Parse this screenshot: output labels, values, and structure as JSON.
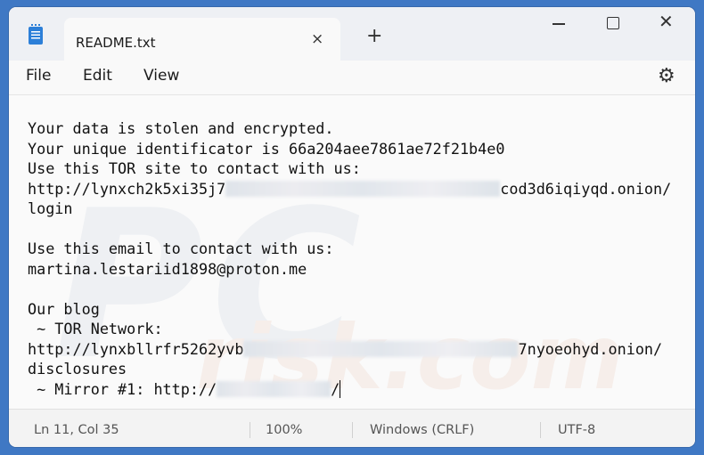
{
  "tab": {
    "title": "README.txt",
    "close_icon": "×",
    "new_tab_icon": "+"
  },
  "window_controls": {
    "close_icon": "✕"
  },
  "menu": {
    "file": "File",
    "edit": "Edit",
    "view": "View",
    "settings_icon": "⚙"
  },
  "editor": {
    "watermark": "PC",
    "watermark2": "risk.com",
    "lines": {
      "l1": "Your data is stolen and encrypted.",
      "l2": "Your unique identificator is 66a204aee7861ae72f21b4e0",
      "l3": "Use this TOR site to contact with us:",
      "l4a": "http://lynxch2k5xi35j7",
      "l4b": "cod3d6iqiyqd.onion/",
      "l5": "login",
      "l7": "Use this email to contact with us:",
      "l8": "martina.lestariid1898@proton.me",
      "l10": "Our blog",
      "l11": " ~ TOR Network:",
      "l12a": "http://lynxbllrfr5262yvb",
      "l12b": "7nyoeohyd.onion/",
      "l13": "disclosures",
      "l14a": " ~ Mirror #1: http://",
      "l14b": "/"
    }
  },
  "status": {
    "position": "Ln 11, Col 35",
    "zoom": "100%",
    "line_ending": "Windows (CRLF)",
    "encoding": "UTF-8"
  }
}
